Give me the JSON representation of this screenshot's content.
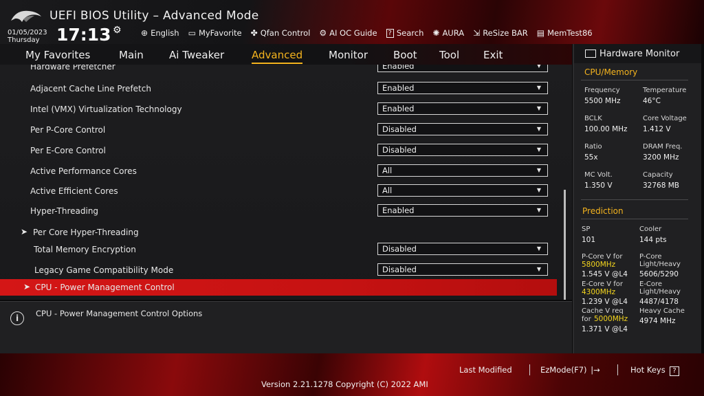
{
  "header": {
    "title": "UEFI BIOS Utility – Advanced Mode",
    "date": "01/05/2023",
    "day": "Thursday",
    "time": "17:13",
    "tools": [
      {
        "label": "English",
        "icon": "globe-icon",
        "glyph": "⊕"
      },
      {
        "label": "MyFavorite",
        "icon": "favorite-icon",
        "glyph": "▭"
      },
      {
        "label": "Qfan Control",
        "icon": "fan-icon",
        "glyph": "✤"
      },
      {
        "label": "AI OC Guide",
        "icon": "ai-oc-icon",
        "glyph": "⚙"
      },
      {
        "label": "Search",
        "icon": "search-icon",
        "glyph": "?"
      },
      {
        "label": "AURA",
        "icon": "aura-icon",
        "glyph": "✺"
      },
      {
        "label": "ReSize BAR",
        "icon": "resize-bar-icon",
        "glyph": "⇲"
      },
      {
        "label": "MemTest86",
        "icon": "memtest-icon",
        "glyph": "▤"
      }
    ]
  },
  "tabs": [
    "My Favorites",
    "Main",
    "Ai Tweaker",
    "Advanced",
    "Monitor",
    "Boot",
    "Tool",
    "Exit"
  ],
  "active_tab": "Advanced",
  "settings": [
    {
      "label": "Hardware Prefetcher",
      "value": "Enabled"
    },
    {
      "label": "Adjacent Cache Line Prefetch",
      "value": "Enabled"
    },
    {
      "label": "Intel (VMX) Virtualization Technology",
      "value": "Enabled"
    },
    {
      "label": "Per P-Core Control",
      "value": "Disabled"
    },
    {
      "label": "Per E-Core Control",
      "value": "Disabled"
    },
    {
      "label": "Active Performance Cores",
      "value": "All"
    },
    {
      "label": "Active Efficient Cores",
      "value": "All"
    },
    {
      "label": "Hyper-Threading",
      "value": "Enabled"
    },
    {
      "label": "Per Core Hyper-Threading",
      "value": ""
    },
    {
      "label": "Total Memory Encryption",
      "value": "Disabled"
    },
    {
      "label": "Legacy Game Compatibility Mode",
      "value": "Disabled"
    },
    {
      "label": "CPU - Power Management Control",
      "value": ""
    }
  ],
  "help_text": "CPU - Power Management Control Options",
  "hw": {
    "title": "Hardware Monitor",
    "cpu_mem_title": "CPU/Memory",
    "frequency_label": "Frequency",
    "frequency": "5500 MHz",
    "temperature_label": "Temperature",
    "temperature": "46°C",
    "bclk_label": "BCLK",
    "bclk": "100.00 MHz",
    "core_voltage_label": "Core Voltage",
    "core_voltage": "1.412 V",
    "ratio_label": "Ratio",
    "ratio": "55x",
    "dram_label": "DRAM Freq.",
    "dram": "3200 MHz",
    "mc_label": "MC Volt.",
    "mc": "1.350 V",
    "capacity_label": "Capacity",
    "capacity": "32768 MB",
    "prediction_title": "Prediction",
    "sp_label": "SP",
    "sp": "101",
    "cooler_label": "Cooler",
    "cooler": "144 pts",
    "pcore_v_label": "P-Core V for",
    "pcore_freq": "5800MHz",
    "pcore_v": "1.545 V @L4",
    "pcore_lh_label1": "P-Core",
    "pcore_lh_label2": "Light/Heavy",
    "pcore_lh": "5606/5290",
    "ecore_v_label": "E-Core V for",
    "ecore_freq": "4300MHz",
    "ecore_v": "1.239 V @L4",
    "ecore_lh_label1": "E-Core",
    "ecore_lh_label2": "Light/Heavy",
    "ecore_lh": "4487/4178",
    "cache_v_label": "Cache V req",
    "cache_for": "for",
    "cache_freq": "5000MHz",
    "cache_v": "1.371 V @L4",
    "heavy_cache_label": "Heavy Cache",
    "heavy_cache": "4974 MHz"
  },
  "footer": {
    "last_modified": "Last Modified",
    "ezmode": "EzMode(F7)",
    "hotkeys": "Hot Keys",
    "hotkeys_glyph": "?",
    "version": "Version 2.21.1278 Copyright (C) 2022 AMI"
  }
}
